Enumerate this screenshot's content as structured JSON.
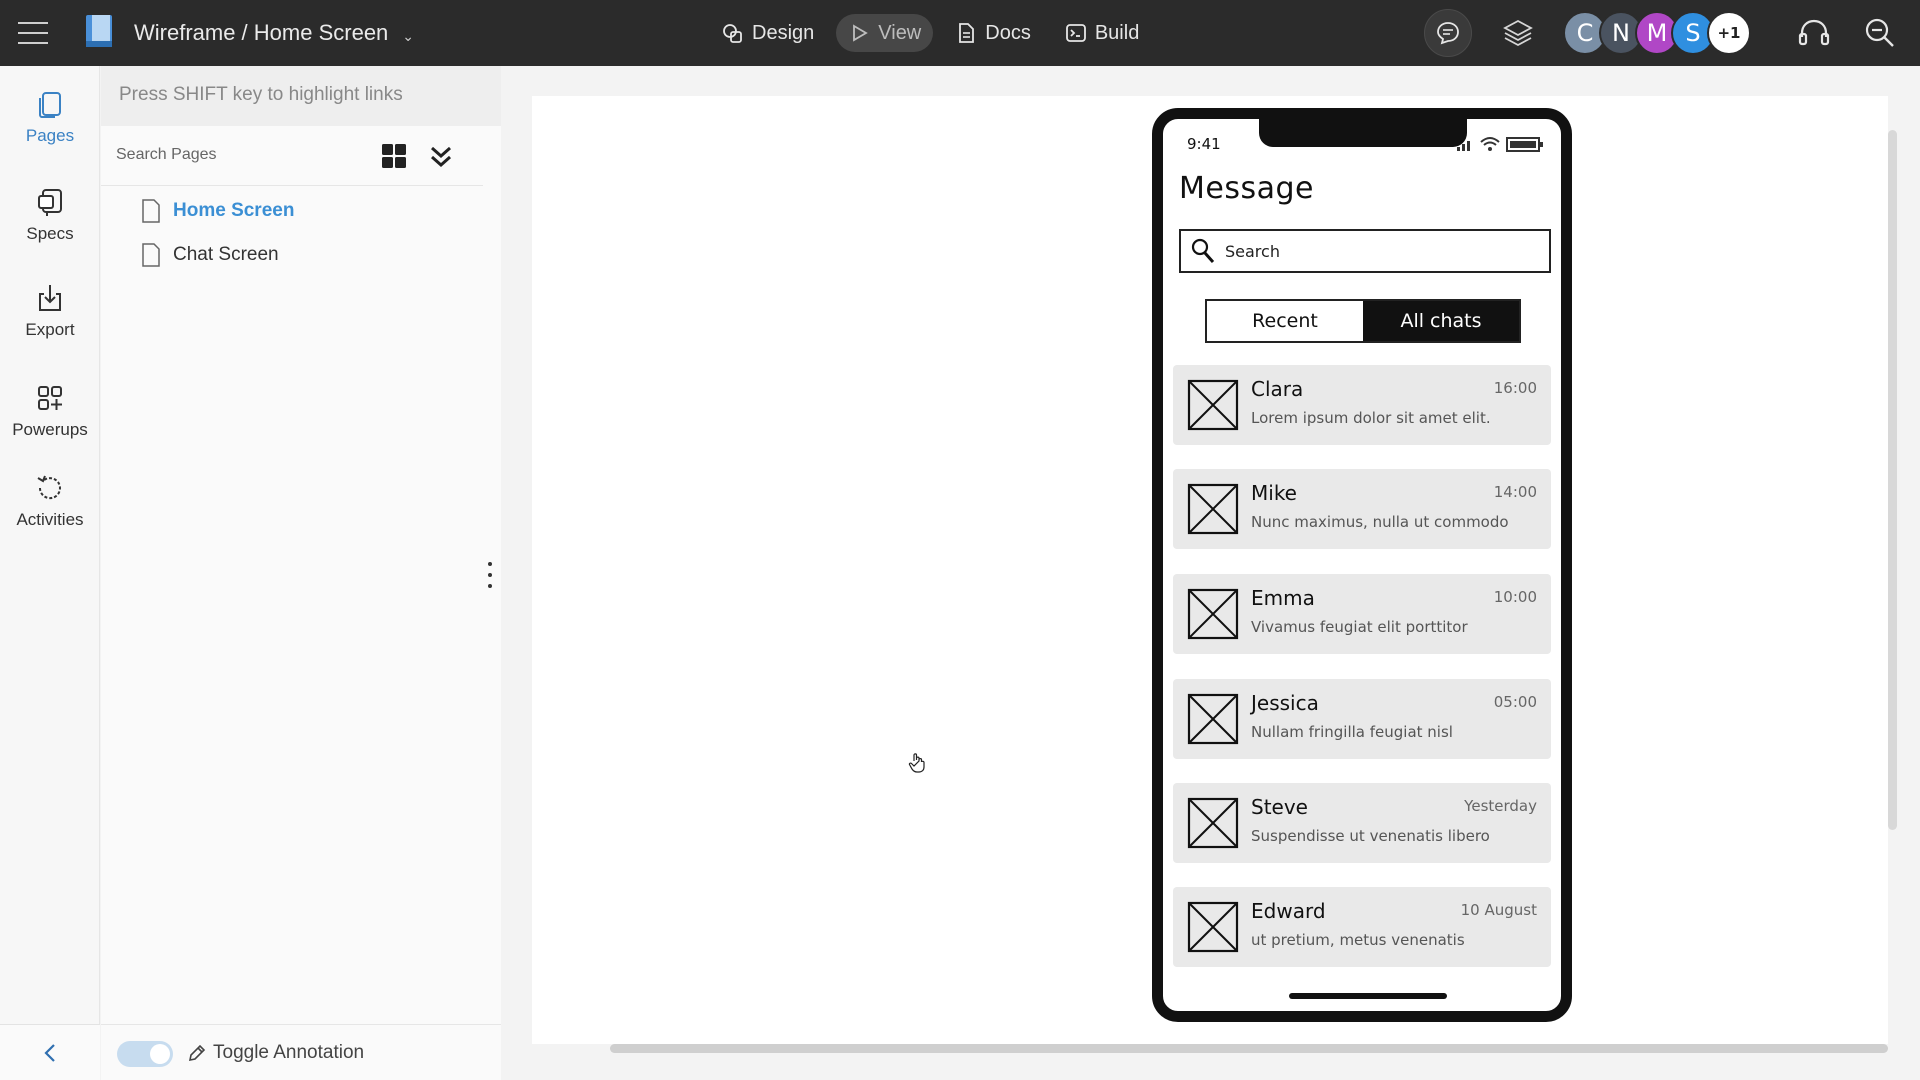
{
  "app": {
    "title": "Wireframe / Home Screen",
    "modes": [
      {
        "label": "Design",
        "icon": "shapes-icon"
      },
      {
        "label": "View",
        "icon": "play-icon",
        "active": true
      },
      {
        "label": "Docs",
        "icon": "document-icon"
      },
      {
        "label": "Build",
        "icon": "terminal-icon"
      }
    ],
    "avatars": [
      {
        "letter": "C",
        "color": "#7a8fa6"
      },
      {
        "letter": "N",
        "color": "#4a5360"
      },
      {
        "letter": "M",
        "color": "#b047c6"
      },
      {
        "letter": "S",
        "color": "#2f8fe0"
      }
    ],
    "extra_collaborators": "+1"
  },
  "rail": {
    "items": [
      {
        "label": "Pages",
        "icon": "pages-icon",
        "active": true
      },
      {
        "label": "Specs",
        "icon": "specs-icon"
      },
      {
        "label": "Export",
        "icon": "export-icon"
      },
      {
        "label": "Powerups",
        "icon": "powerups-icon"
      },
      {
        "label": "Activities",
        "icon": "history-icon"
      }
    ]
  },
  "panel": {
    "hint": "Press SHIFT key to highlight links",
    "search_placeholder": "Search Pages",
    "pages": [
      {
        "label": "Home Screen",
        "active": true
      },
      {
        "label": "Chat Screen"
      }
    ],
    "toggle_annotation_label": "Toggle Annotation",
    "toggle_on": true
  },
  "phone": {
    "time": "9:41",
    "title": "Message",
    "search_placeholder": "Search",
    "tabs": [
      "Recent",
      "All chats"
    ],
    "active_tab": "All chats",
    "chats": [
      {
        "name": "Clara",
        "time": "16:00",
        "message": "Lorem ipsum dolor sit amet elit."
      },
      {
        "name": "Mike",
        "time": "14:00",
        "message": "Nunc maximus, nulla ut commodo"
      },
      {
        "name": "Emma",
        "time": "10:00",
        "message": "Vivamus feugiat elit porttitor"
      },
      {
        "name": "Jessica",
        "time": "05:00",
        "message": "Nullam fringilla feugiat nisl"
      },
      {
        "name": "Steve",
        "time": "Yesterday",
        "message": "Suspendisse ut venenatis libero"
      },
      {
        "name": "Edward",
        "time": "10 August",
        "message": "ut pretium, metus venenatis"
      }
    ]
  },
  "colors": {
    "topbar": "#2b2b2b",
    "accent": "#3b8fd4",
    "canvas": "#ffffff"
  }
}
